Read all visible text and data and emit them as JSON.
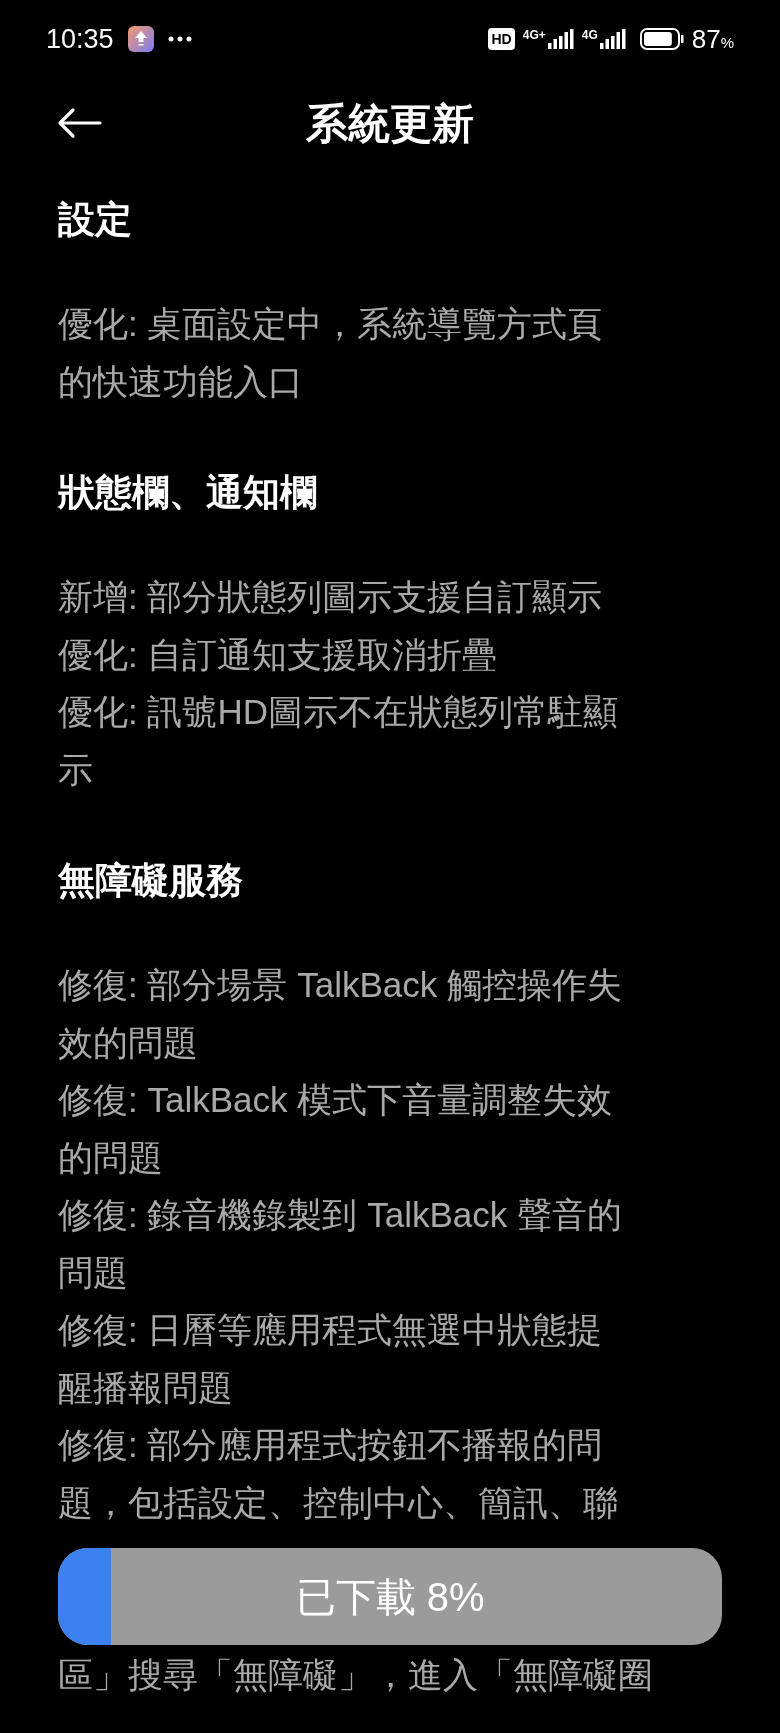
{
  "status_bar": {
    "time": "10:35",
    "network_badge": "HD",
    "sim_1": "4G+",
    "sim_2": "4G",
    "battery": "87",
    "battery_unit": "%"
  },
  "header": {
    "title": "系統更新"
  },
  "sections": [
    {
      "heading": "設定",
      "items": [
        {
          "kind": "entry",
          "lines": [
            "優化: 桌面設定中，系統導覽方式頁",
            "的快速功能入口"
          ]
        }
      ]
    },
    {
      "heading": "狀態欄、通知欄",
      "items": [
        {
          "kind": "entry",
          "lines": [
            "新增: 部分狀態列圖示支援自訂顯示"
          ]
        },
        {
          "kind": "entry",
          "lines": [
            "優化: 自訂通知支援取消折疊"
          ]
        },
        {
          "kind": "entry",
          "lines": [
            "優化: 訊號HD圖示不在狀態列常駐顯",
            "示"
          ]
        }
      ]
    },
    {
      "heading": "無障礙服務",
      "items": [
        {
          "kind": "entry",
          "lines": [
            "修復: 部分場景 TalkBack 觸控操作失",
            "效的問題"
          ]
        },
        {
          "kind": "entry",
          "lines": [
            "修復: TalkBack 模式下音量調整失效",
            "的問題"
          ]
        },
        {
          "kind": "entry",
          "lines": [
            "修復: 錄音機錄製到 TalkBack 聲音的",
            "問題"
          ]
        },
        {
          "kind": "entry",
          "lines": [
            "修復: 日曆等應用程式無選中狀態提",
            "醒播報問題"
          ]
        },
        {
          "kind": "entry",
          "lines": [
            "修復: 部分應用程式按鈕不播報的問",
            "題，包括設定、控制中心、簡訊、聯"
          ]
        },
        {
          "kind": "covered",
          "lines": [
            "區」搜尋「無障礙」，進入「無障礙圈"
          ]
        }
      ]
    }
  ],
  "download_button": {
    "label": "已下載 8%",
    "level": 0.08
  }
}
